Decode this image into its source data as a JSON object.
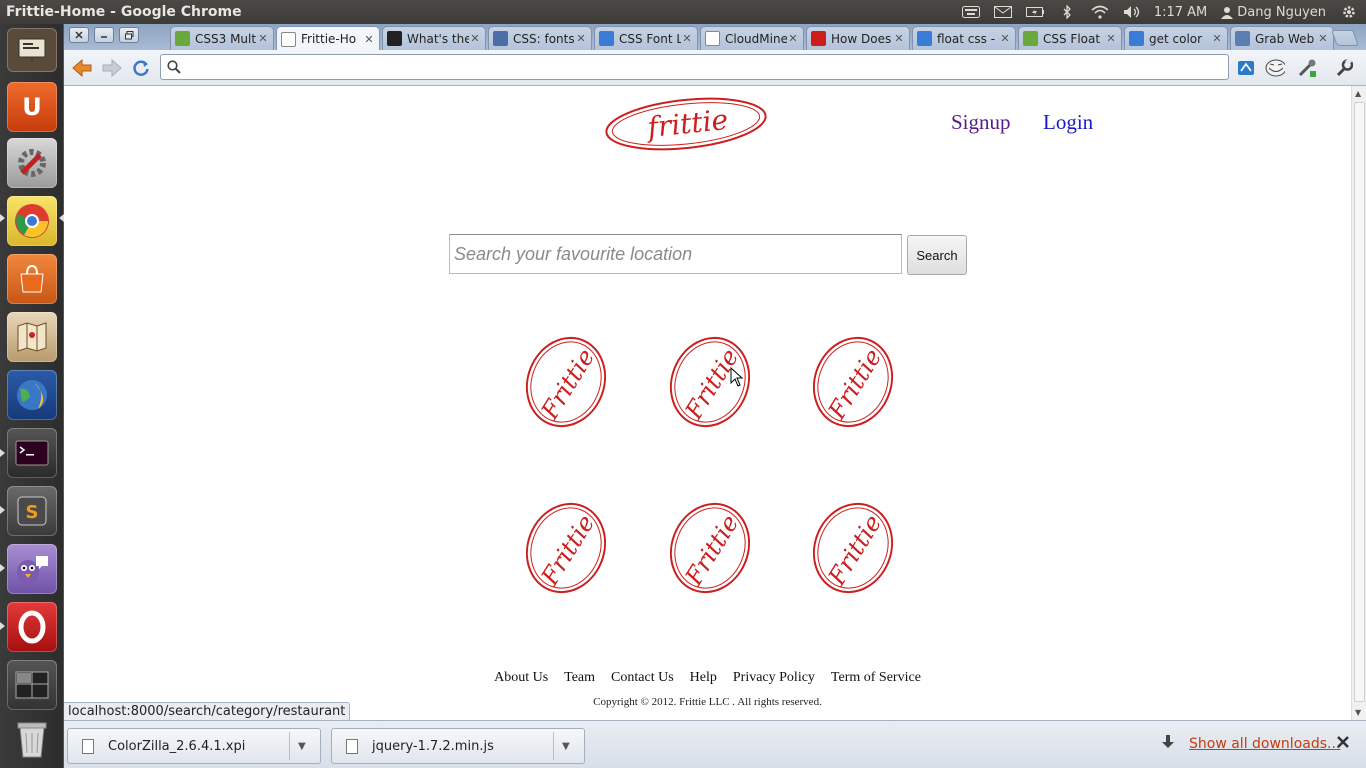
{
  "window": {
    "title": "Frittie-Home - Google Chrome"
  },
  "tray": {
    "clock": "1:17 AM",
    "user": "Dang Nguyen"
  },
  "tabs": [
    {
      "title": "CSS3 Mult",
      "fav": "w3",
      "color": "#6aa83c"
    },
    {
      "title": "Frittie-Ho",
      "fav": "doc",
      "color": "#ffffff",
      "active": true
    },
    {
      "title": "What's the",
      "fav": "S",
      "color": "#222222"
    },
    {
      "title": "CSS: fonts",
      "fav": "W3",
      "color": "#4a6fa8"
    },
    {
      "title": "CSS Font L",
      "fav": "g",
      "color": "#3a7bd5"
    },
    {
      "title": "CloudMine",
      "fav": "doc",
      "color": "#ffffff"
    },
    {
      "title": "How Does",
      "fav": "yt",
      "color": "#cc1d1d"
    },
    {
      "title": "float css -",
      "fav": "g",
      "color": "#3a7bd5"
    },
    {
      "title": "CSS Float",
      "fav": "w3",
      "color": "#6aa83c"
    },
    {
      "title": "get color",
      "fav": "g",
      "color": "#3a7bd5"
    },
    {
      "title": "Grab Web",
      "fav": "gw",
      "color": "#5a7fb0"
    }
  ],
  "omnibox": {
    "value": "",
    "placeholder": ""
  },
  "site": {
    "logo_text": "frittie",
    "signup": "Signup",
    "login": "Login",
    "search_placeholder": "Search your favourite location",
    "search_button": "Search",
    "category_logo_text": "Frittie",
    "footer_links": [
      "About Us",
      "Team",
      "Contact Us",
      "Help",
      "Privacy Policy",
      "Term of Service"
    ],
    "copyright": "Copyright © 2012. Frittie LLC . All rights reserved.",
    "brand_color": "#cc1f1f",
    "link_visited_color": "#551a8b",
    "link_color": "#1a1acc"
  },
  "status_url": "localhost:8000/search/category/restaurant",
  "downloads": [
    {
      "name": "ColorZilla_2.6.4.1.xpi"
    },
    {
      "name": "jquery-1.7.2.min.js"
    }
  ],
  "show_all_downloads": "Show all downloads..."
}
